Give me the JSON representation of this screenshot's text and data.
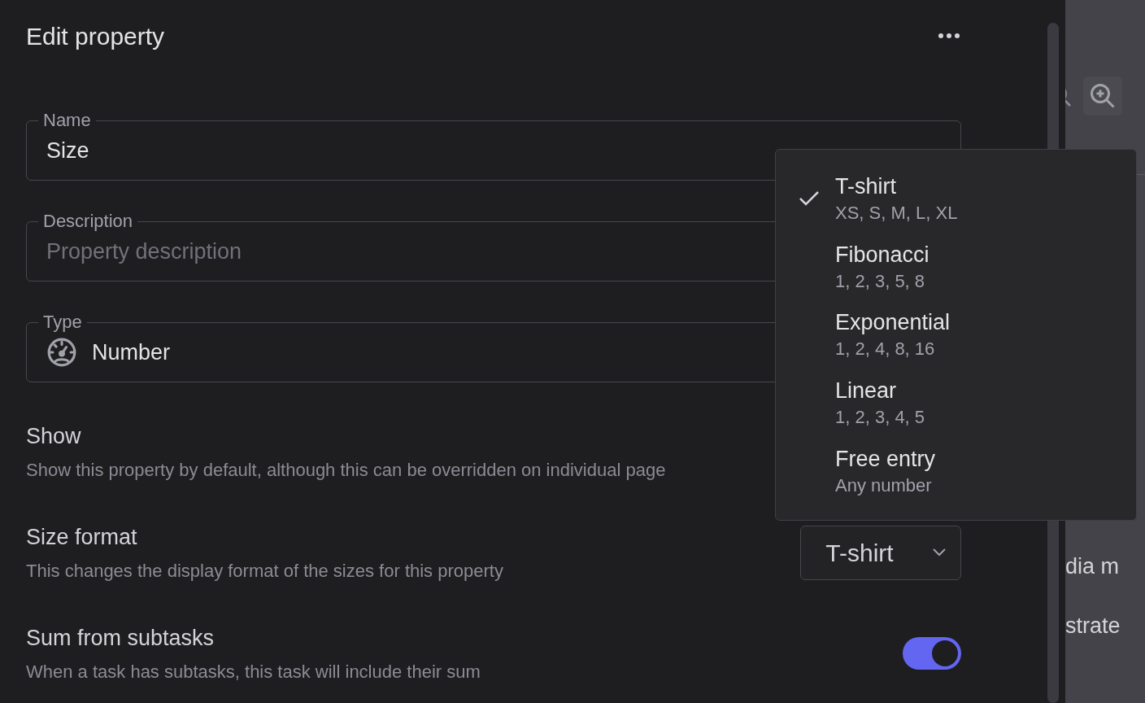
{
  "panel": {
    "title": "Edit property",
    "fields": [
      {
        "kind": "text",
        "label": "Name",
        "value": "Size"
      },
      {
        "kind": "text",
        "label": "Description",
        "placeholder": "Property description"
      },
      {
        "kind": "type",
        "label": "Type",
        "value": "Number"
      }
    ],
    "settings": [
      {
        "kind": "plain",
        "title": "Show",
        "description": "Show this property by default, although this can be overridden on individual page"
      },
      {
        "kind": "select",
        "title": "Size format",
        "description": "This changes the display format of the sizes for this property",
        "value": "T-shirt"
      },
      {
        "kind": "toggle",
        "title": "Sum from subtasks",
        "description": "When a task has subtasks, this task will include their sum",
        "on": true
      }
    ]
  },
  "dropdown": {
    "options": [
      {
        "label": "T-shirt",
        "detail": "XS, S, M, L, XL",
        "selected": true
      },
      {
        "label": "Fibonacci",
        "detail": "1, 2, 3, 5, 8",
        "selected": false
      },
      {
        "label": "Exponential",
        "detail": "1, 2, 4, 8, 16",
        "selected": false
      },
      {
        "label": "Linear",
        "detail": "1, 2, 3, 4, 5",
        "selected": false
      },
      {
        "label": "Free entry",
        "detail": "Any number",
        "selected": false
      }
    ]
  },
  "background": {
    "rows": [
      "dia m",
      "strate"
    ]
  }
}
